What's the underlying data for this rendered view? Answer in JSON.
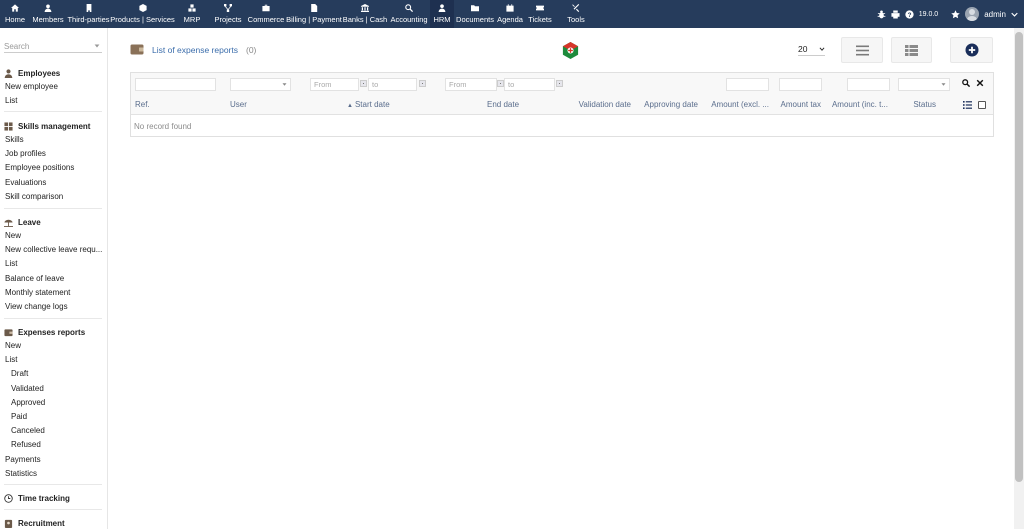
{
  "topmenu": [
    {
      "label": "Home",
      "icon": "home-icon"
    },
    {
      "label": "Members",
      "icon": "members-icon"
    },
    {
      "label": "Third-parties",
      "icon": "building-icon"
    },
    {
      "label": "Products | Services",
      "icon": "cube-icon"
    },
    {
      "label": "MRP",
      "icon": "cubes-icon"
    },
    {
      "label": "Projects",
      "icon": "project-tree-icon"
    },
    {
      "label": "Commerce",
      "icon": "briefcase-icon"
    },
    {
      "label": "Billing | Payment",
      "icon": "invoice-icon"
    },
    {
      "label": "Banks | Cash",
      "icon": "bank-icon"
    },
    {
      "label": "Accounting",
      "icon": "search-dollar-icon"
    },
    {
      "label": "HRM",
      "icon": "user-tie-icon",
      "active": true
    },
    {
      "label": "Documents",
      "icon": "folder-icon"
    },
    {
      "label": "Agenda",
      "icon": "calendar-icon"
    },
    {
      "label": "Tickets",
      "icon": "ticket-icon"
    },
    {
      "label": "Tools",
      "icon": "tools-icon"
    }
  ],
  "topright": {
    "version": "19.0.0",
    "user": "admin"
  },
  "sidebar": {
    "search_placeholder": "Search",
    "employees": {
      "title": "Employees",
      "links": [
        "New employee",
        "List"
      ]
    },
    "skills": {
      "title": "Skills management",
      "links": [
        "Skills",
        "Job profiles",
        "Employee positions",
        "Evaluations",
        "Skill comparison"
      ]
    },
    "leave": {
      "title": "Leave",
      "links": [
        "New",
        "New collective leave requ...",
        "List",
        "Balance of leave",
        "Monthly statement",
        "View change logs"
      ]
    },
    "expenses": {
      "title": "Expenses reports",
      "links": [
        "New",
        "List"
      ],
      "sublinks": [
        "Draft",
        "Validated",
        "Approved",
        "Paid",
        "Canceled",
        "Refused"
      ],
      "links2": [
        "Payments",
        "Statistics"
      ]
    },
    "timetracking": {
      "title": "Time tracking"
    },
    "recruitment": {
      "title": "Recruitment"
    }
  },
  "main": {
    "title": "List of expense reports",
    "count": "(0)",
    "limit": "20",
    "filters": {
      "from": "From",
      "to": "to"
    },
    "columns": [
      "Ref.",
      "User",
      "Start date",
      "End date",
      "Validation date",
      "Approving date",
      "Amount (excl. ...",
      "Amount tax",
      "Amount (inc. t...",
      "Status"
    ],
    "sort_indicator": "▲",
    "empty_message": "No record found"
  },
  "colors": {
    "topbar": "#263c5c",
    "link": "#3b6dab",
    "header_text": "#5a6d8c"
  }
}
